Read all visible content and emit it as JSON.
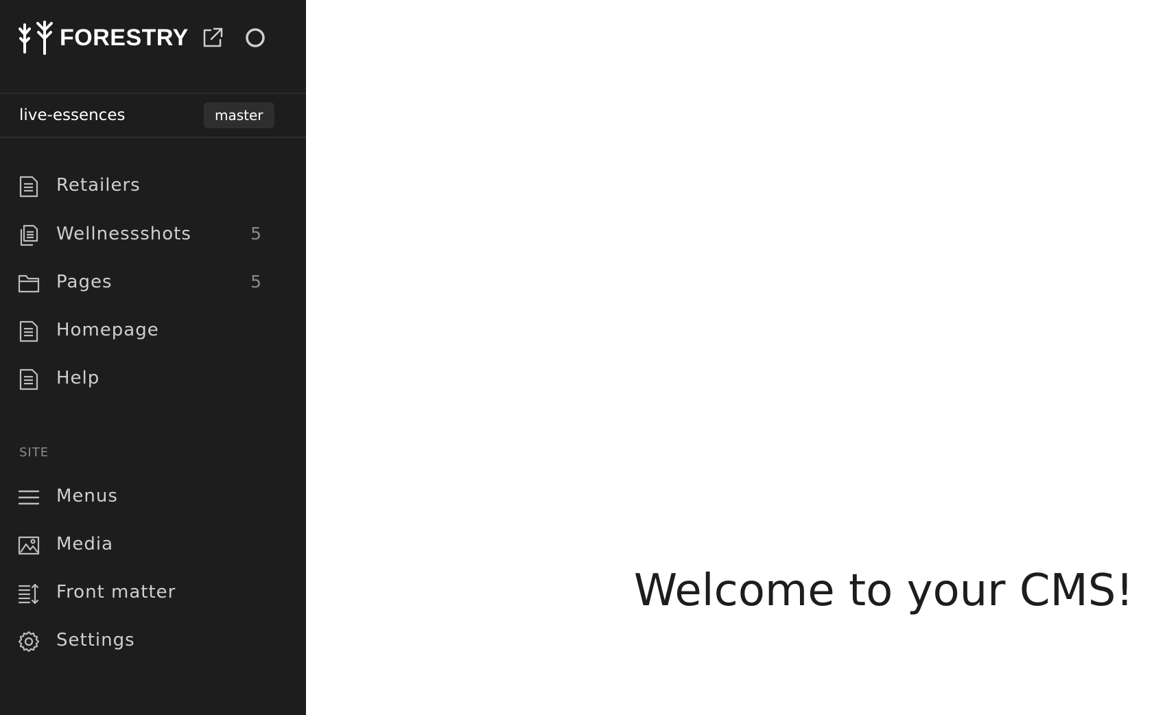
{
  "app": {
    "logo_text": "FORESTRY",
    "icons": [
      "forestry-logo-icon",
      "external-link-icon",
      "status-circle-icon"
    ]
  },
  "repo": {
    "name": "live-essences",
    "branch": "master"
  },
  "nav": {
    "items": [
      {
        "label": "Retailers",
        "count": "",
        "icon": "document-icon"
      },
      {
        "label": "Wellnessshots",
        "count": "5",
        "icon": "documents-icon"
      },
      {
        "label": "Pages",
        "count": "5",
        "icon": "folder-icon"
      },
      {
        "label": "Homepage",
        "count": "",
        "icon": "document-icon"
      },
      {
        "label": "Help",
        "count": "",
        "icon": "document-icon"
      }
    ]
  },
  "site": {
    "section_label": "SITE",
    "items": [
      {
        "label": "Menus",
        "icon": "menu-icon"
      },
      {
        "label": "Media",
        "icon": "image-icon"
      },
      {
        "label": "Front matter",
        "icon": "front-matter-icon"
      },
      {
        "label": "Settings",
        "icon": "gear-icon"
      }
    ]
  },
  "main": {
    "welcome": "Welcome to your CMS!"
  },
  "colors": {
    "sidebar_bg": "#1d1d1d",
    "main_bg": "#ffffff",
    "text_light": "#cfcfcf",
    "muted": "#8a8a8a"
  }
}
